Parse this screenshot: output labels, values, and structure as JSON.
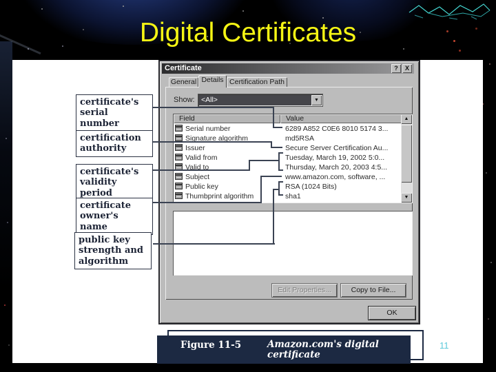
{
  "slide": {
    "title": "Digital Certificates",
    "page_number": "11",
    "colors": {
      "title_yellow": "#f5f514",
      "page_number_cyan": "#5cc9da",
      "caption_navy": "#1c2942",
      "callout_line": "#3a4252",
      "dialog_face": "#bcbcbc"
    }
  },
  "callout_labels": [
    {
      "text": "certificate's serial number"
    },
    {
      "text": "certification authority"
    },
    {
      "text": "certificate's validity period"
    },
    {
      "text": "certificate owner's name"
    },
    {
      "text": "public key strength and algorithm"
    }
  ],
  "dialog": {
    "title": "Certificate",
    "icons": {
      "help": "?",
      "close": "X",
      "dropdown_arrow": "▼",
      "scroll_up": "▲",
      "scroll_down": "▼"
    },
    "tabs": [
      {
        "label": "General"
      },
      {
        "label": "Details"
      },
      {
        "label": "Certification Path"
      }
    ],
    "active_tab": "Details",
    "show_label": "Show:",
    "show_value": "<All>",
    "table": {
      "headers": [
        "Field",
        "Value"
      ],
      "rows": [
        {
          "field": "Serial number",
          "value": "6289 A852 C0E6 8010 5174 3..."
        },
        {
          "field": "Signature algorithm",
          "value": "md5RSA"
        },
        {
          "field": "Issuer",
          "value": "Secure Server Certification Au..."
        },
        {
          "field": "Valid from",
          "value": "Tuesday, March 19, 2002 5:0..."
        },
        {
          "field": "Valid to",
          "value": "Thursday, March 20, 2003 4:5..."
        },
        {
          "field": "Subject",
          "value": "www.amazon.com, software, ..."
        },
        {
          "field": "Public key",
          "value": "RSA (1024 Bits)"
        },
        {
          "field": "Thumbprint algorithm",
          "value": "sha1"
        }
      ]
    },
    "buttons": {
      "edit_properties": "Edit Properties...",
      "copy_to_file": "Copy to File...",
      "ok": "OK"
    }
  },
  "caption": {
    "figure": "Figure 11-5",
    "text": "Amazon.com's digital certificate"
  }
}
